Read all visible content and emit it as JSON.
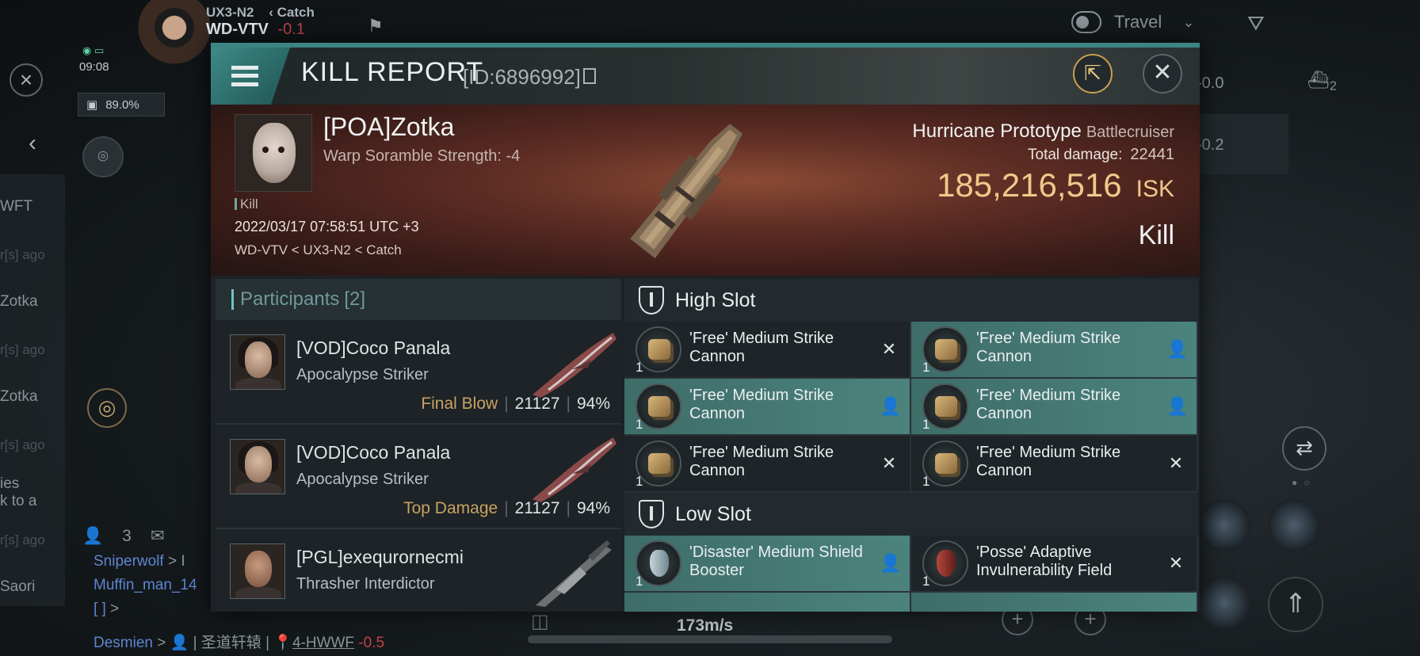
{
  "hud": {
    "system_parent": "UX3-N2",
    "system_context": "Catch",
    "system_name": "WD-VTV",
    "system_security": "-0.1",
    "clock": "09:08",
    "cargo_percent": "89.0%",
    "travel_label": "Travel",
    "right_values": [
      "-0.0",
      "-0.2"
    ],
    "ship_count": "2",
    "left_snippets": [
      "WFT",
      "r[s] ago",
      "Zotka",
      "r[s] ago",
      "Zotka",
      "r[s] ago",
      "ies",
      "k to a",
      "r[s] ago",
      "Saori"
    ],
    "people_count": "3",
    "chat": [
      {
        "name": "Sniperwolf",
        "suffix": " > I"
      },
      {
        "name": "Muffin_man_14",
        "suffix": ""
      },
      {
        "name": "[ ]",
        "suffix": " >"
      },
      {
        "name": "Desmien",
        "suffix": " > 👤 | 圣道轩辕 | 📍",
        "location": "4-HWWF",
        "loc_sec": "-0.5"
      }
    ],
    "speed": "173m/s"
  },
  "dialog": {
    "title": "KILL REPORT",
    "report_id": "[ID:6896992]"
  },
  "victim": {
    "name": "[POA]Zotka",
    "scramble": "Warp Soramble Strength: -4",
    "kill_tag": "Kill",
    "datetime": "2022/03/17 07:58:51 UTC +3",
    "location": "WD-VTV < UX3-N2 < Catch",
    "ship_name": "Hurricane Prototype",
    "ship_class": "Battlecruiser",
    "total_damage_label": "Total damage:",
    "total_damage": "22441",
    "isk_value": "185,216,516",
    "isk_unit": "ISK",
    "result": "Kill"
  },
  "participants": {
    "label": "Participants",
    "count": "[2]",
    "items": [
      {
        "name": "[VOD]Coco Panala",
        "ship": "Apocalypse Striker",
        "role": "Final Blow",
        "damage": "21127",
        "percent": "94%"
      },
      {
        "name": "[VOD]Coco Panala",
        "ship": "Apocalypse Striker",
        "role": "Top Damage",
        "damage": "21127",
        "percent": "94%"
      },
      {
        "name": "[PGL]exequrornecmi",
        "ship": "Thrasher Interdictor",
        "role": "",
        "damage": "",
        "percent": ""
      }
    ]
  },
  "fittings": {
    "high_slot": {
      "label": "High Slot",
      "modules": [
        {
          "qty": "1",
          "name": "'Free' Medium Strike Cannon",
          "status": "destroyed",
          "icon": "cannon-icon",
          "highlight": false
        },
        {
          "qty": "1",
          "name": "'Free' Medium Strike Cannon",
          "status": "dropped",
          "icon": "cannon-icon",
          "highlight": true
        },
        {
          "qty": "1",
          "name": "'Free' Medium Strike Cannon",
          "status": "dropped",
          "icon": "cannon-icon",
          "highlight": true
        },
        {
          "qty": "1",
          "name": "'Free' Medium Strike Cannon",
          "status": "dropped",
          "icon": "cannon-icon",
          "highlight": true
        },
        {
          "qty": "1",
          "name": "'Free' Medium Strike Cannon",
          "status": "destroyed",
          "icon": "cannon-icon",
          "highlight": false
        },
        {
          "qty": "1",
          "name": "'Free' Medium Strike Cannon",
          "status": "destroyed",
          "icon": "cannon-icon",
          "highlight": false
        }
      ]
    },
    "low_slot": {
      "label": "Low Slot",
      "modules": [
        {
          "qty": "1",
          "name": "'Disaster' Medium Shield Booster",
          "status": "dropped",
          "icon": "shield-booster-icon",
          "highlight": true
        },
        {
          "qty": "1",
          "name": "'Posse' Adaptive Invulnerability Field",
          "status": "destroyed",
          "icon": "hardener-icon",
          "highlight": false
        }
      ]
    }
  },
  "colors": {
    "accent_teal": "#3e8a87",
    "isk_gold": "#f1c88a",
    "role_gold": "#c9a262",
    "security_negative": "#c24545"
  }
}
